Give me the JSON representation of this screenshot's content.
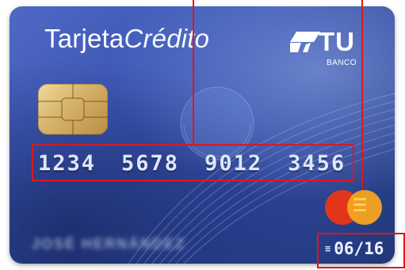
{
  "card": {
    "title_part1": "Tarjeta",
    "title_part2": "Crédito",
    "brand": "TU",
    "brand_sub": "BANCO",
    "number_groups": [
      "1234",
      "5678",
      "9012",
      "3456"
    ],
    "holder": "JOSÉ HERNÁNDEZ",
    "expiry": "06/16",
    "expiry_marker": "≡",
    "colors": {
      "highlight": "#e0161c",
      "card_blue": "#3b56b4",
      "mc_red": "#e1361c",
      "mc_orange": "#f7a320"
    },
    "icons": [
      "chip-icon",
      "bank-logo-icon",
      "mastercard-logo-icon"
    ]
  }
}
